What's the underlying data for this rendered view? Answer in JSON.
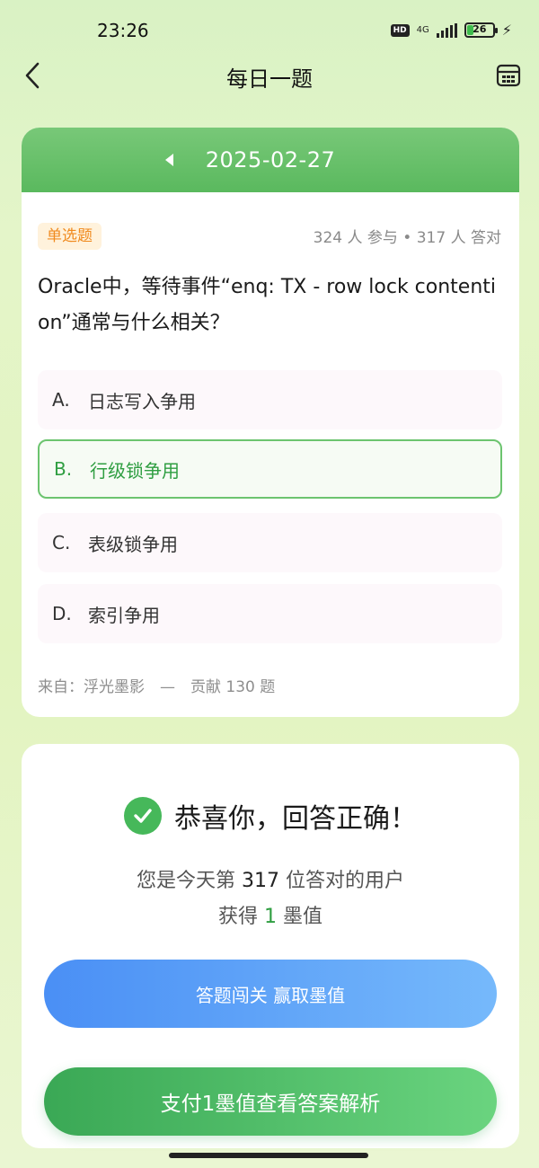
{
  "status_bar": {
    "time": "23:26",
    "hd": "HD",
    "network": "4G",
    "battery_level": "26",
    "battery_fraction": 0.26
  },
  "header": {
    "title": "每日一题",
    "back_icon": "chevron-left-icon",
    "calendar_icon": "calendar-icon"
  },
  "question": {
    "date": "2025-02-27",
    "type": "单选题",
    "stats": "324 人 参与 • 317 人 答对",
    "text": "Oracle中，等待事件“enq: TX - row lock contention”通常与什么相关？",
    "options": [
      {
        "letter": "A.",
        "text": "日志写入争用",
        "selected": false
      },
      {
        "letter": "B.",
        "text": "行级锁争用",
        "selected": true
      },
      {
        "letter": "C.",
        "text": "表级锁争用",
        "selected": false
      },
      {
        "letter": "D.",
        "text": "索引争用",
        "selected": false
      }
    ],
    "source": "来自：浮光墨影　—　贡献 130 题"
  },
  "result": {
    "title": "恭喜你，回答正确！",
    "rank_prefix": "您是今天第",
    "rank_number": "317",
    "rank_suffix": "位答对的用户",
    "reward_prefix": "获得",
    "reward_number": "1",
    "reward_suffix": "墨值",
    "challenge_button": "答题闯关 赢取墨值",
    "pay_button": "支付1墨值查看答案解析"
  },
  "colors": {
    "brand_green": "#5ab95e",
    "tag_orange": "#f08a1e",
    "button_blue": "#4a8ff5",
    "correct_green": "#2f9e41"
  }
}
